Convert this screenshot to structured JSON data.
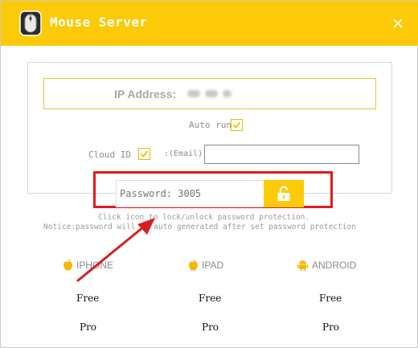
{
  "window": {
    "title": "Mouse Server",
    "close_icon": "close-icon",
    "accent_color": "#fcca08"
  },
  "connection": {
    "ip_label": "IP Address:",
    "autorun_label": "Auto run",
    "autorun_checked": true,
    "cloud_label": "Cloud ID",
    "cloud_checked": true,
    "email_label": ":(Email)",
    "email_value": ""
  },
  "password": {
    "placeholder": "Password: 3005",
    "value": "",
    "lock_icon": "unlock-icon",
    "highlight_color": "#e01c1c"
  },
  "notices": {
    "line1": "Click icon to lock/unlock password protection.",
    "line2": "Notice:password will be auto generated after set password protection"
  },
  "platforms": [
    {
      "name": "IPHONE",
      "icon": "apple-icon",
      "plans": [
        "Free",
        "Pro"
      ]
    },
    {
      "name": "IPAD",
      "icon": "apple-icon",
      "plans": [
        "Free",
        "Pro"
      ]
    },
    {
      "name": "ANDROID",
      "icon": "android-icon",
      "plans": [
        "Free",
        "Pro"
      ]
    }
  ]
}
